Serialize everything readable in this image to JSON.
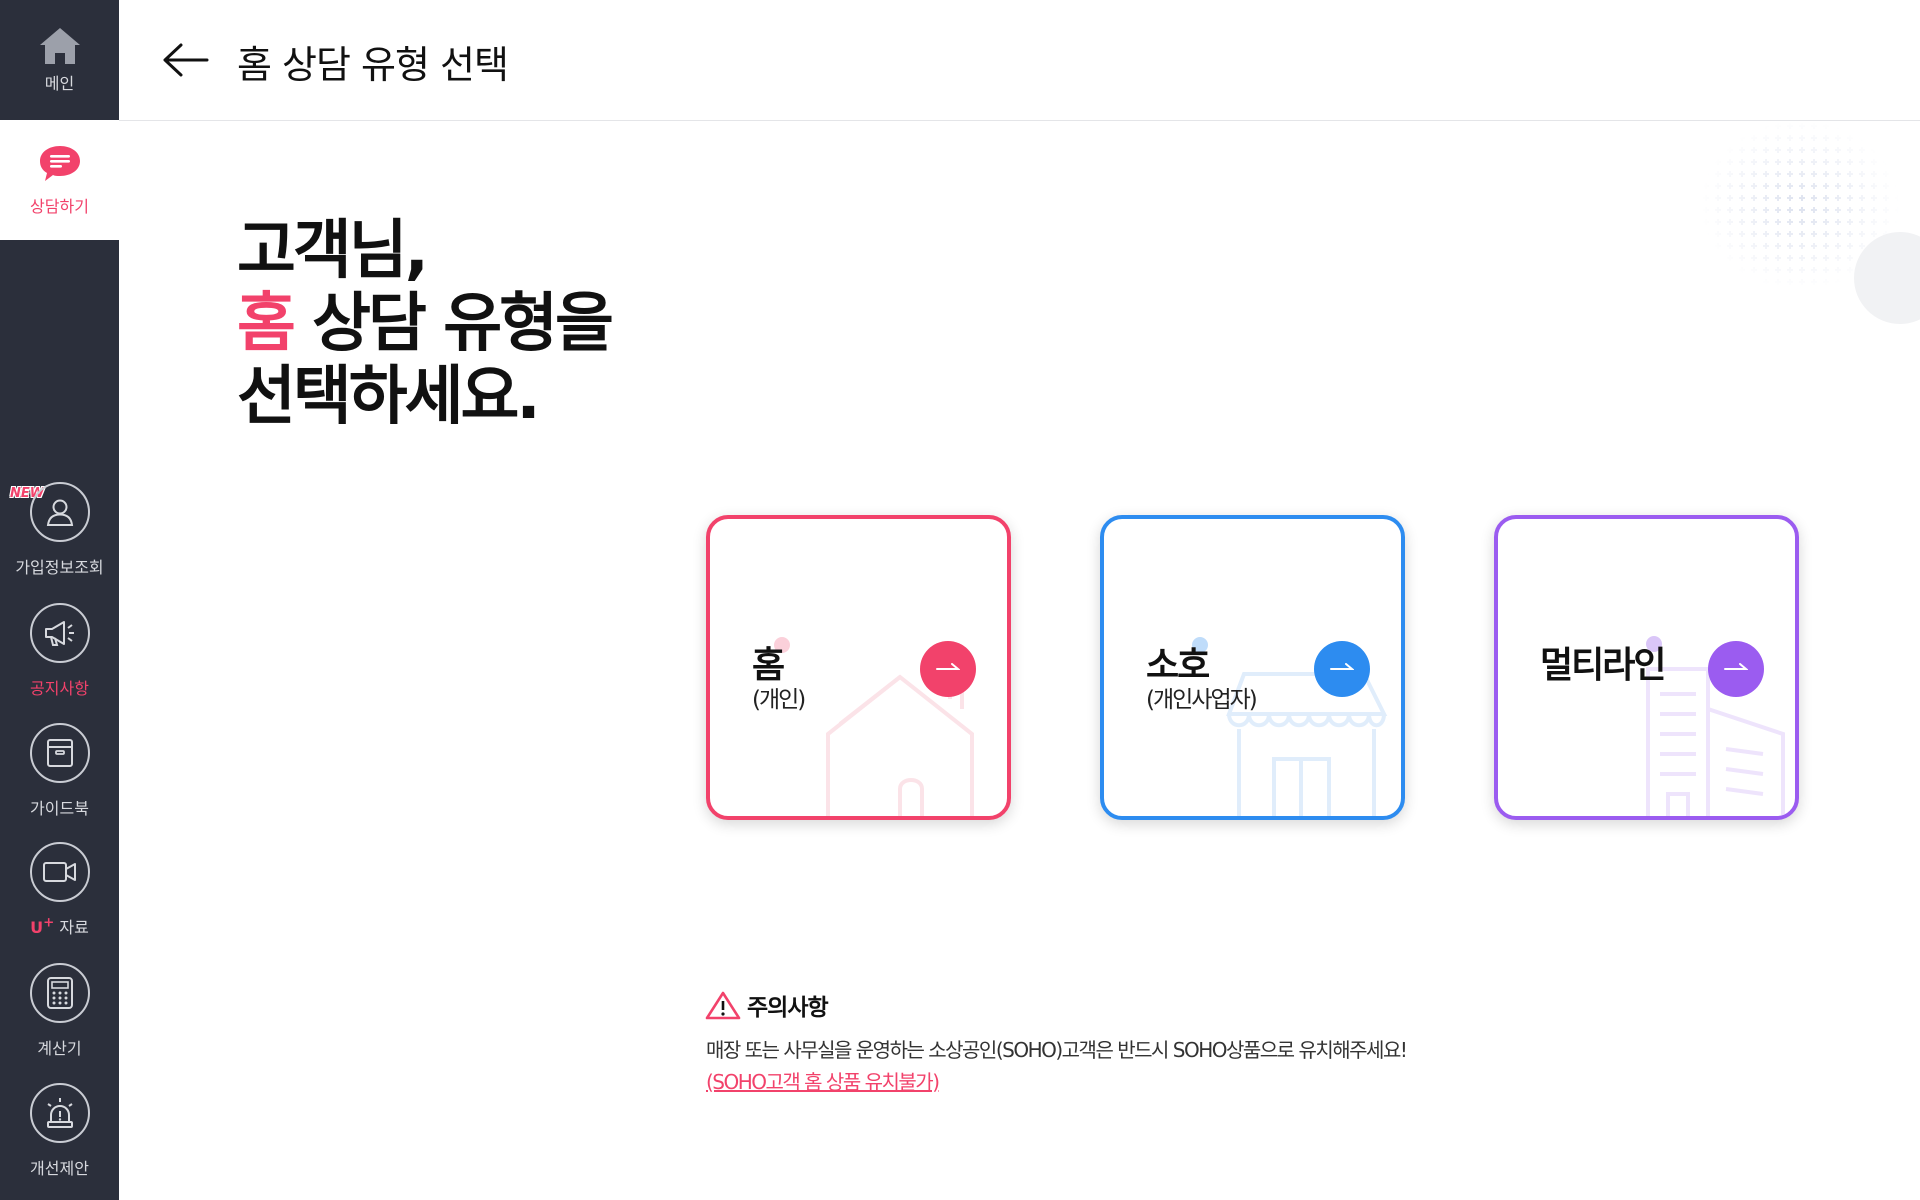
{
  "sidebar": {
    "home": {
      "label": "메인",
      "icon": "home-icon"
    },
    "consult": {
      "label": "상담하기",
      "icon": "chat-bubble-icon"
    },
    "new_badge": "NEW",
    "items": [
      {
        "label": "가입정보조회",
        "icon": "user-icon"
      },
      {
        "label": "공지사항",
        "icon": "megaphone-icon"
      },
      {
        "label": "가이드북",
        "icon": "guidebook-icon"
      },
      {
        "label_prefix": "U",
        "label_sup": "+",
        "label": "자료",
        "icon": "video-camera-icon"
      },
      {
        "label": "계산기",
        "icon": "calculator-icon"
      },
      {
        "label": "개선제안",
        "icon": "siren-icon"
      }
    ]
  },
  "header": {
    "title": "홈 상담 유형 선택",
    "back_icon": "arrow-left-icon"
  },
  "headline": {
    "line1": "고객님,",
    "line2_highlight": "홈",
    "line2_rest": " 상담 유형을",
    "line3": "선택하세요."
  },
  "cards": [
    {
      "title": "홈",
      "subtitle": "(개인)",
      "color": "#f2426b",
      "icon": "house-icon"
    },
    {
      "title": "소호",
      "subtitle": "(개인사업자)",
      "color": "#2d8cf0",
      "icon": "store-icon"
    },
    {
      "title": "멀티라인",
      "subtitle": "",
      "color": "#9b5cf0",
      "icon": "building-icon"
    }
  ],
  "caution": {
    "title": "주의사항",
    "text": "매장 또는 사무실을 운영하는 소상공인(SOHO)고객은 반드시 SOHO상품으로 유치해주세요!",
    "link": "(SOHO고객 홈 상품 유치불가)"
  },
  "colors": {
    "accent": "#f2426b",
    "sidebar_bg": "#2b2f3b",
    "blue": "#2d8cf0",
    "purple": "#9b5cf0"
  }
}
